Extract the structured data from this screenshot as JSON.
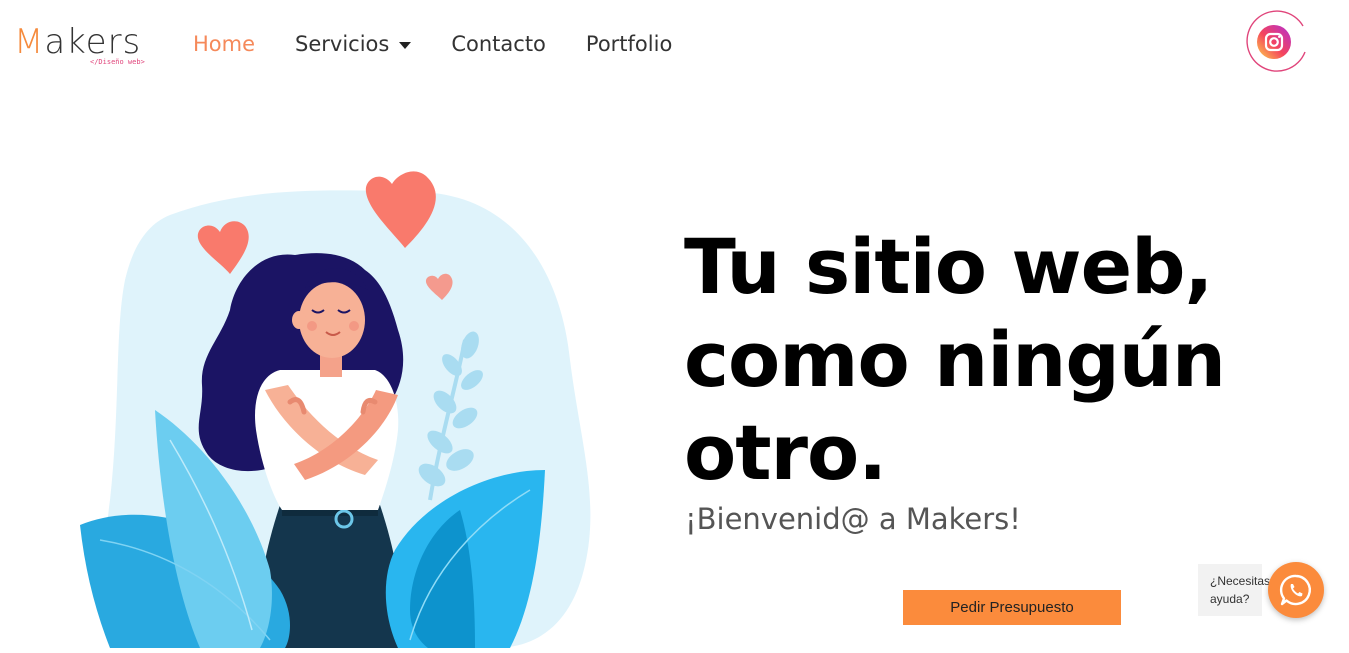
{
  "header": {
    "logo": {
      "initial": "M",
      "rest": "akers",
      "tagline": "</Diseño web>"
    },
    "nav": [
      {
        "label": "Home"
      },
      {
        "label": "Servicios"
      },
      {
        "label": "Contacto"
      },
      {
        "label": "Portfolio"
      }
    ],
    "social_icon": "instagram-icon"
  },
  "hero": {
    "headline": [
      "Tu sitio web,",
      "como ningún",
      "otro."
    ],
    "subheadline": "¡Bienvenid@ a Makers!",
    "cta_label": "Pedir Presupuesto"
  },
  "help_widget": {
    "line1": "¿Necesitas",
    "line2": "ayuda?",
    "icon": "whatsapp-icon"
  },
  "colors": {
    "accent": "#fb8b3c",
    "nav_active": "#f5895a",
    "heart": "#f97a6c",
    "leaf": "#29a9e0",
    "blob": "#dff3fb",
    "hair": "#1b1464",
    "pants": "#14364d"
  }
}
